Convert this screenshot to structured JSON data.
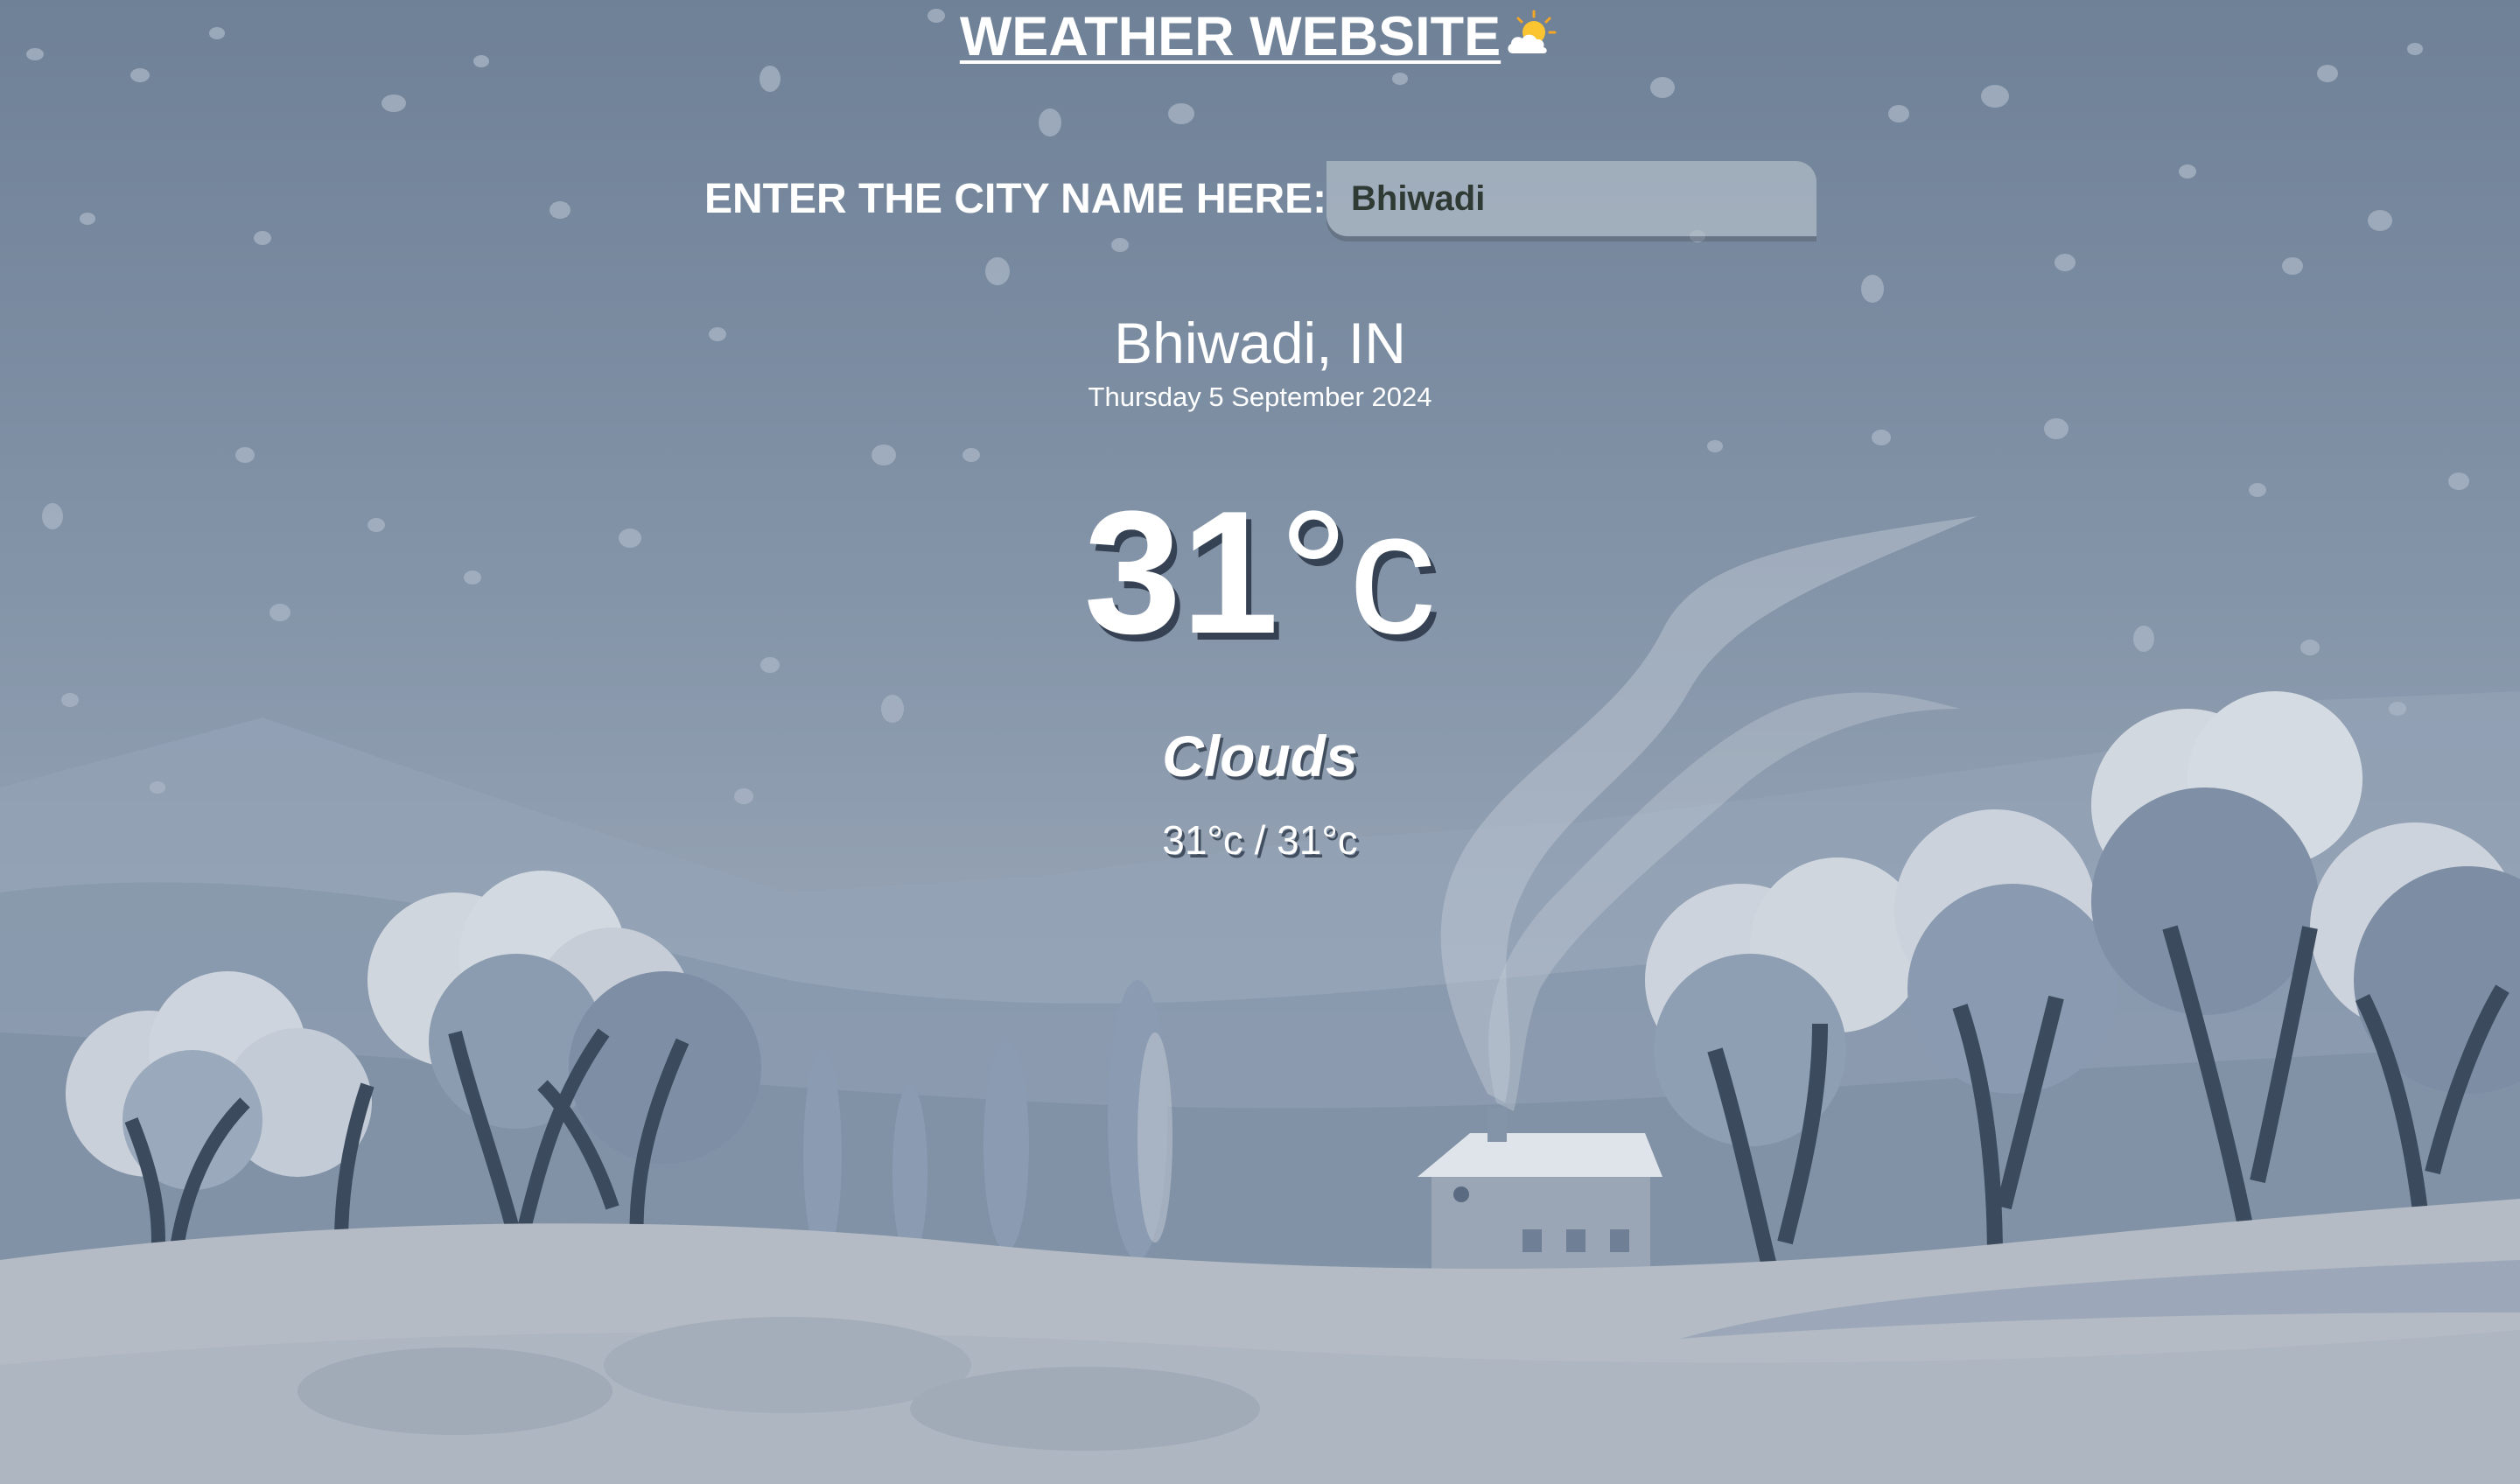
{
  "header": {
    "title": "WEATHER WEBSITE",
    "title_icon": "sun-behind-cloud-icon"
  },
  "search": {
    "label": "ENTER THE CITY NAME HERE:",
    "value": "Bhiwadi"
  },
  "weather": {
    "location": "Bhiwadi, IN",
    "date": "Thursday 5 September 2024",
    "temperature": "31",
    "unit": "°c",
    "condition": "Clouds",
    "hi_lo": "31°c / 31°c"
  },
  "colors": {
    "text": "#ffffff",
    "sky_top": "#6f8197",
    "ground": "#b6bcc6",
    "tree_trunk": "#3b4a5c"
  },
  "background": {
    "scene": "snowy-winter-landscape",
    "elements": [
      "snowflakes",
      "snow-covered-trees",
      "hills",
      "cottage-with-chimney-smoke"
    ]
  }
}
